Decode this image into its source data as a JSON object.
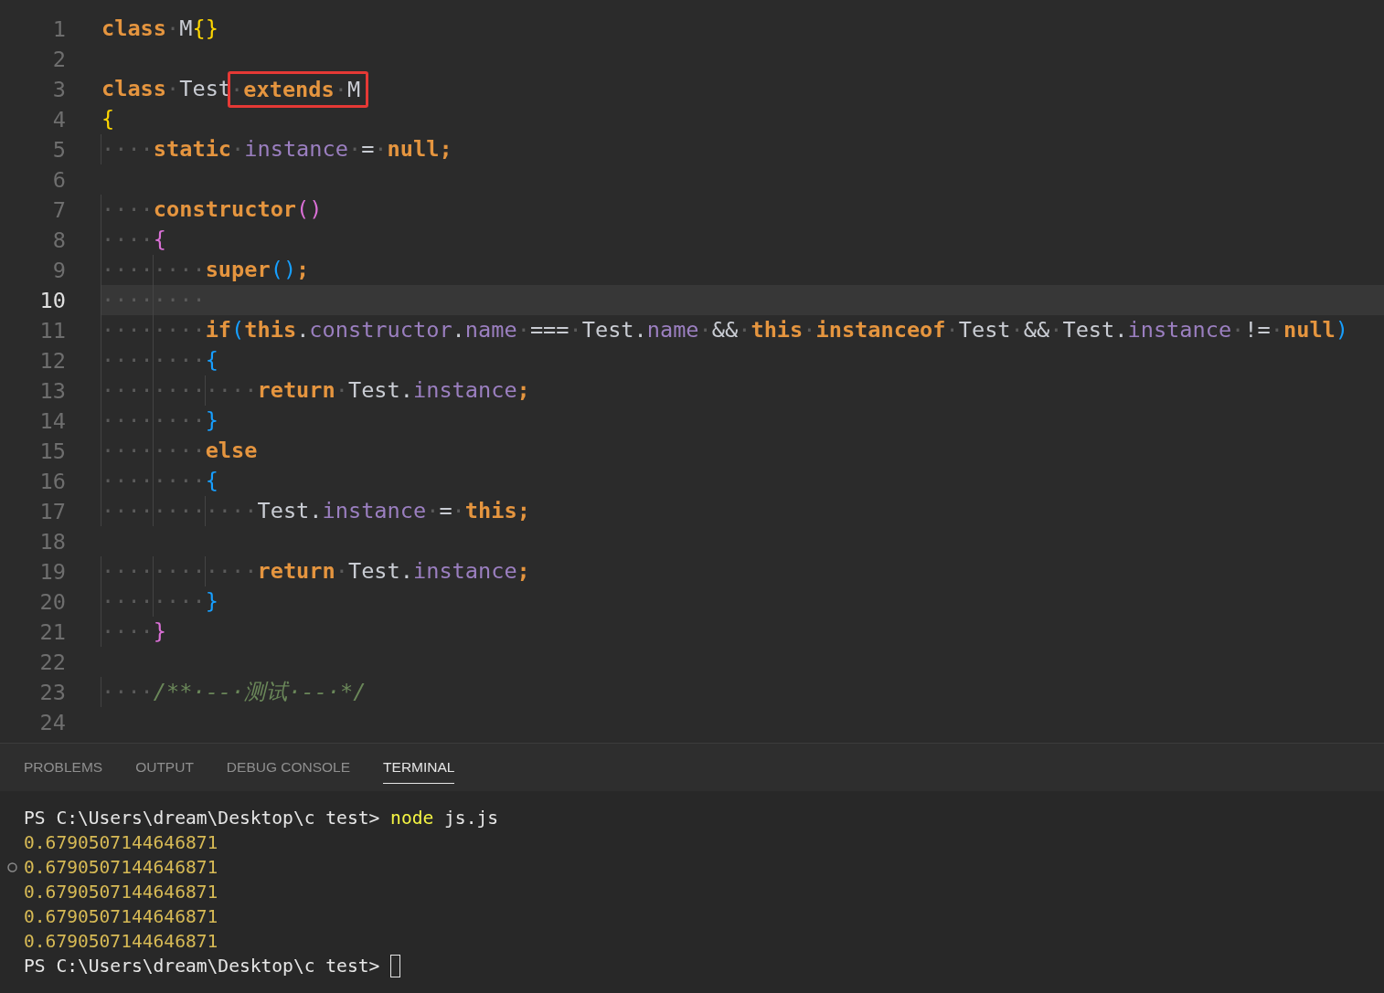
{
  "editor": {
    "lines": [
      {
        "number": "1",
        "current": false,
        "tokens": [
          {
            "kind": "kw",
            "text": "class"
          },
          {
            "kind": "ws",
            "text": "·"
          },
          {
            "kind": "id",
            "text": "M"
          },
          {
            "kind": "b1",
            "text": "{}"
          }
        ]
      },
      {
        "number": "2",
        "current": false
      },
      {
        "number": "3",
        "current": false,
        "tokens": [
          {
            "kind": "kw",
            "text": "class"
          },
          {
            "kind": "ws",
            "text": "·"
          },
          {
            "kind": "id",
            "text": "Test"
          },
          {
            "kind": "box",
            "tokens": [
              {
                "kind": "ws",
                "text": "·"
              },
              {
                "kind": "kw",
                "text": "extends"
              },
              {
                "kind": "ws",
                "text": "·"
              },
              {
                "kind": "id",
                "text": "M"
              }
            ]
          }
        ]
      },
      {
        "number": "4",
        "current": false,
        "tokens": [
          {
            "kind": "b1",
            "text": "{"
          }
        ]
      },
      {
        "number": "5",
        "current": false,
        "tokens": [
          {
            "kind": "ws",
            "text": "····"
          },
          {
            "kind": "kw",
            "text": "static"
          },
          {
            "kind": "ws",
            "text": "·"
          },
          {
            "kind": "prop",
            "text": "instance"
          },
          {
            "kind": "ws",
            "text": "·"
          },
          {
            "kind": "id",
            "text": "="
          },
          {
            "kind": "ws",
            "text": "·"
          },
          {
            "kind": "kw",
            "text": "null;"
          }
        ]
      },
      {
        "number": "6",
        "current": false
      },
      {
        "number": "7",
        "current": false,
        "tokens": [
          {
            "kind": "ws",
            "text": "····"
          },
          {
            "kind": "kw",
            "text": "constructor"
          },
          {
            "kind": "b2",
            "text": "()"
          }
        ]
      },
      {
        "number": "8",
        "current": false,
        "tokens": [
          {
            "kind": "ws",
            "text": "····"
          },
          {
            "kind": "b2",
            "text": "{"
          }
        ]
      },
      {
        "number": "9",
        "current": false,
        "tokens": [
          {
            "kind": "ws",
            "text": "········"
          },
          {
            "kind": "kw",
            "text": "super"
          },
          {
            "kind": "b3",
            "text": "()"
          },
          {
            "kind": "kw",
            "text": ";"
          }
        ]
      },
      {
        "number": "10",
        "current": true,
        "tokens": [
          {
            "kind": "ws",
            "text": "········"
          }
        ]
      },
      {
        "number": "11",
        "current": false,
        "tokens": [
          {
            "kind": "ws",
            "text": "········"
          },
          {
            "kind": "kw",
            "text": "if"
          },
          {
            "kind": "b3",
            "text": "("
          },
          {
            "kind": "kw",
            "text": "this"
          },
          {
            "kind": "id",
            "text": "."
          },
          {
            "kind": "prop",
            "text": "constructor"
          },
          {
            "kind": "id",
            "text": "."
          },
          {
            "kind": "prop",
            "text": "name"
          },
          {
            "kind": "ws",
            "text": "·"
          },
          {
            "kind": "id",
            "text": "==="
          },
          {
            "kind": "ws",
            "text": "·"
          },
          {
            "kind": "id",
            "text": "Test."
          },
          {
            "kind": "prop",
            "text": "name"
          },
          {
            "kind": "ws",
            "text": "·"
          },
          {
            "kind": "id",
            "text": "&&"
          },
          {
            "kind": "ws",
            "text": "·"
          },
          {
            "kind": "kw",
            "text": "this"
          },
          {
            "kind": "ws",
            "text": "·"
          },
          {
            "kind": "kw",
            "text": "instanceof"
          },
          {
            "kind": "ws",
            "text": "·"
          },
          {
            "kind": "id",
            "text": "Test"
          },
          {
            "kind": "ws",
            "text": "·"
          },
          {
            "kind": "id",
            "text": "&&"
          },
          {
            "kind": "ws",
            "text": "·"
          },
          {
            "kind": "id",
            "text": "Test."
          },
          {
            "kind": "prop",
            "text": "instance"
          },
          {
            "kind": "ws",
            "text": "·"
          },
          {
            "kind": "id",
            "text": "!="
          },
          {
            "kind": "ws",
            "text": "·"
          },
          {
            "kind": "kw",
            "text": "null"
          },
          {
            "kind": "b3",
            "text": ")"
          }
        ]
      },
      {
        "number": "12",
        "current": false,
        "tokens": [
          {
            "kind": "ws",
            "text": "········"
          },
          {
            "kind": "b3",
            "text": "{"
          }
        ]
      },
      {
        "number": "13",
        "current": false,
        "tokens": [
          {
            "kind": "ws",
            "text": "············"
          },
          {
            "kind": "kw",
            "text": "return"
          },
          {
            "kind": "ws",
            "text": "·"
          },
          {
            "kind": "id",
            "text": "Test."
          },
          {
            "kind": "prop",
            "text": "instance"
          },
          {
            "kind": "kw",
            "text": ";"
          }
        ]
      },
      {
        "number": "14",
        "current": false,
        "tokens": [
          {
            "kind": "ws",
            "text": "········"
          },
          {
            "kind": "b3",
            "text": "}"
          }
        ]
      },
      {
        "number": "15",
        "current": false,
        "tokens": [
          {
            "kind": "ws",
            "text": "········"
          },
          {
            "kind": "kw",
            "text": "else"
          }
        ]
      },
      {
        "number": "16",
        "current": false,
        "tokens": [
          {
            "kind": "ws",
            "text": "········"
          },
          {
            "kind": "b3",
            "text": "{"
          }
        ]
      },
      {
        "number": "17",
        "current": false,
        "tokens": [
          {
            "kind": "ws",
            "text": "············"
          },
          {
            "kind": "id",
            "text": "Test."
          },
          {
            "kind": "prop",
            "text": "instance"
          },
          {
            "kind": "ws",
            "text": "·"
          },
          {
            "kind": "id",
            "text": "="
          },
          {
            "kind": "ws",
            "text": "·"
          },
          {
            "kind": "kw",
            "text": "this;"
          }
        ]
      },
      {
        "number": "18",
        "current": false
      },
      {
        "number": "19",
        "current": false,
        "tokens": [
          {
            "kind": "ws",
            "text": "············"
          },
          {
            "kind": "kw",
            "text": "return"
          },
          {
            "kind": "ws",
            "text": "·"
          },
          {
            "kind": "id",
            "text": "Test."
          },
          {
            "kind": "prop",
            "text": "instance"
          },
          {
            "kind": "kw",
            "text": ";"
          }
        ]
      },
      {
        "number": "20",
        "current": false,
        "tokens": [
          {
            "kind": "ws",
            "text": "········"
          },
          {
            "kind": "b3",
            "text": "}"
          }
        ]
      },
      {
        "number": "21",
        "current": false,
        "tokens": [
          {
            "kind": "ws",
            "text": "····"
          },
          {
            "kind": "b2",
            "text": "}"
          }
        ]
      },
      {
        "number": "22",
        "current": false
      },
      {
        "number": "23",
        "current": false,
        "tokens": [
          {
            "kind": "ws",
            "text": "····"
          },
          {
            "kind": "comment",
            "text": "/**·--·测试·--·*/"
          }
        ]
      },
      {
        "number": "24",
        "current": false
      }
    ]
  },
  "panel": {
    "tabs": [
      {
        "label": "PROBLEMS",
        "selected": false
      },
      {
        "label": "OUTPUT",
        "selected": false
      },
      {
        "label": "DEBUG CONSOLE",
        "selected": false
      },
      {
        "label": "TERMINAL",
        "selected": true
      }
    ],
    "terminal": [
      {
        "decorated": false,
        "cursor": false,
        "tokens": [
          {
            "kind": "plain",
            "text": "PS C:\\Users\\dream\\Desktop\\c test> "
          },
          {
            "kind": "cmd",
            "text": "node"
          },
          {
            "kind": "plain",
            "text": " js.js"
          }
        ]
      },
      {
        "decorated": false,
        "cursor": false,
        "tokens": [
          {
            "kind": "num",
            "text": "0.6790507144646871"
          }
        ]
      },
      {
        "decorated": true,
        "cursor": false,
        "tokens": [
          {
            "kind": "num",
            "text": "0.6790507144646871"
          }
        ]
      },
      {
        "decorated": false,
        "cursor": false,
        "tokens": [
          {
            "kind": "num",
            "text": "0.6790507144646871"
          }
        ]
      },
      {
        "decorated": false,
        "cursor": false,
        "tokens": [
          {
            "kind": "num",
            "text": "0.6790507144646871"
          }
        ]
      },
      {
        "decorated": false,
        "cursor": false,
        "tokens": [
          {
            "kind": "num",
            "text": "0.6790507144646871"
          }
        ]
      },
      {
        "decorated": false,
        "cursor": true,
        "tokens": [
          {
            "kind": "plain",
            "text": "PS C:\\Users\\dream\\Desktop\\c test> "
          }
        ]
      }
    ]
  }
}
